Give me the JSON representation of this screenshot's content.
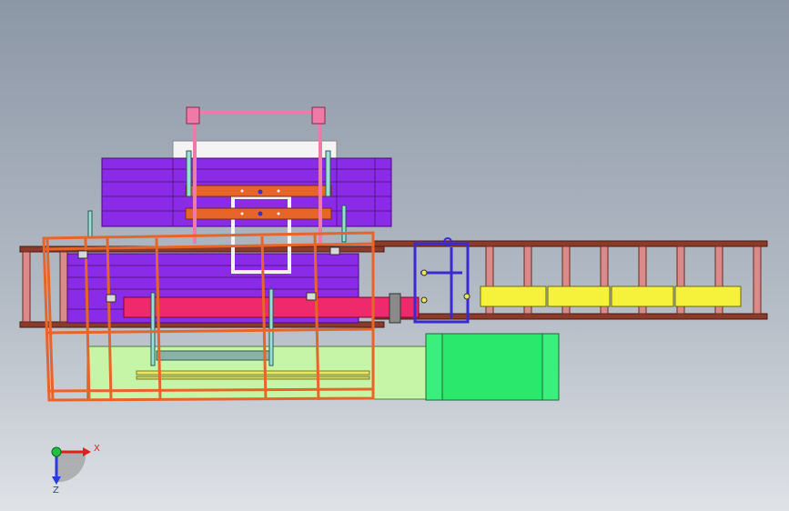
{
  "viewport": {
    "background_top": "#8c97a6",
    "background_bottom": "#dfe2e6"
  },
  "colors": {
    "frame_orange": "#e8652a",
    "frame_dark": "#9b2a1e",
    "rail_brown": "#8a3b2c",
    "roller_pink": "#d98a8a",
    "purple_body": "#8a2be8",
    "purple_dark": "#5a148c",
    "magenta_beam": "#ee2a6c",
    "pink_gantry": "#ee7aa8",
    "light_green": "#c6f5a8",
    "green_box": "#2ae86c",
    "yellow_block": "#f6f23c",
    "blue_frame": "#3a2ad0",
    "cylinder": "#9ae0d8",
    "white_plate": "#f4f4f4",
    "axis_x": "#e02020",
    "axis_z": "#2a3ae0",
    "axis_origin": "#20c040"
  },
  "triad": {
    "x_label": "X",
    "z_label": "Z"
  }
}
